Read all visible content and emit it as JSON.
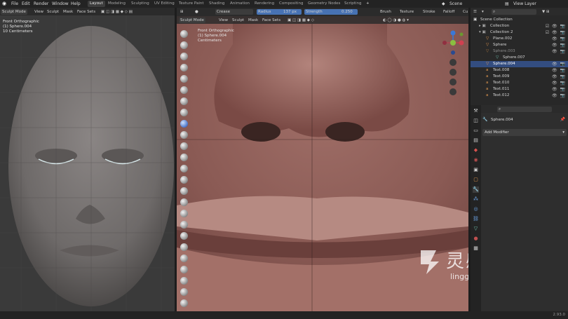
{
  "menu": {
    "items": [
      "File",
      "Edit",
      "Render",
      "Window",
      "Help"
    ]
  },
  "workspaces": [
    "Layout",
    "Modeling",
    "Sculpting",
    "UV Editing",
    "Texture Paint",
    "Shading",
    "Animation",
    "Rendering",
    "Compositing",
    "Geometry Nodes",
    "Scripting"
  ],
  "active_workspace": "Layout",
  "scene": {
    "label": "Scene"
  },
  "view_layer": {
    "label": "View Layer"
  },
  "left_viewport": {
    "header": {
      "mode": "Sculpt Mode",
      "view": "View",
      "sculpt": "Sculpt",
      "mask": "Mask",
      "face_sets": "Face Sets"
    },
    "info": {
      "view_name": "Front Orthographic",
      "object": "(1) Sphere.004",
      "scale": "10 Centimeters"
    }
  },
  "tool_settings": {
    "brush_name": "Crease",
    "radius_label": "Radius",
    "radius_value": "137 px",
    "strength_label": "Strength",
    "strength_value": "0.250",
    "brush": "Brush",
    "texture": "Texture",
    "stroke": "Stroke",
    "falloff": "Falloff",
    "cursor": "Cu"
  },
  "right_viewport": {
    "header": {
      "mode": "Sculpt Mode",
      "view": "View",
      "sculpt": "Sculpt",
      "mask": "Mask",
      "face_sets": "Face Sets"
    },
    "info": {
      "view_name": "Front Orthographic",
      "object": "(1) Sphere.004",
      "scale": "Centimeters"
    }
  },
  "outliner": {
    "title": "Scene Collection",
    "rows": [
      {
        "label": "Collection"
      },
      {
        "label": "Collection 2"
      },
      {
        "label": "Plane.002"
      },
      {
        "label": "Sphere"
      },
      {
        "label": "Sphere.003"
      },
      {
        "label": "Sphere.007"
      },
      {
        "label": "Sphere.004"
      },
      {
        "label": "Text.008"
      },
      {
        "label": "Text.009"
      },
      {
        "label": "Text.010"
      },
      {
        "label": "Text.011"
      },
      {
        "label": "Text.012"
      }
    ]
  },
  "properties": {
    "object_name": "Sphere.004",
    "add_modifier": "Add Modifier"
  },
  "watermark": {
    "cn": "灵感中国",
    "url": "lingganchina.com"
  },
  "status": {
    "version": "2.93.0"
  },
  "colors": {
    "selection_blue": "#334d80",
    "skin": "#8a5a54",
    "head_gray": "#7a7676"
  }
}
